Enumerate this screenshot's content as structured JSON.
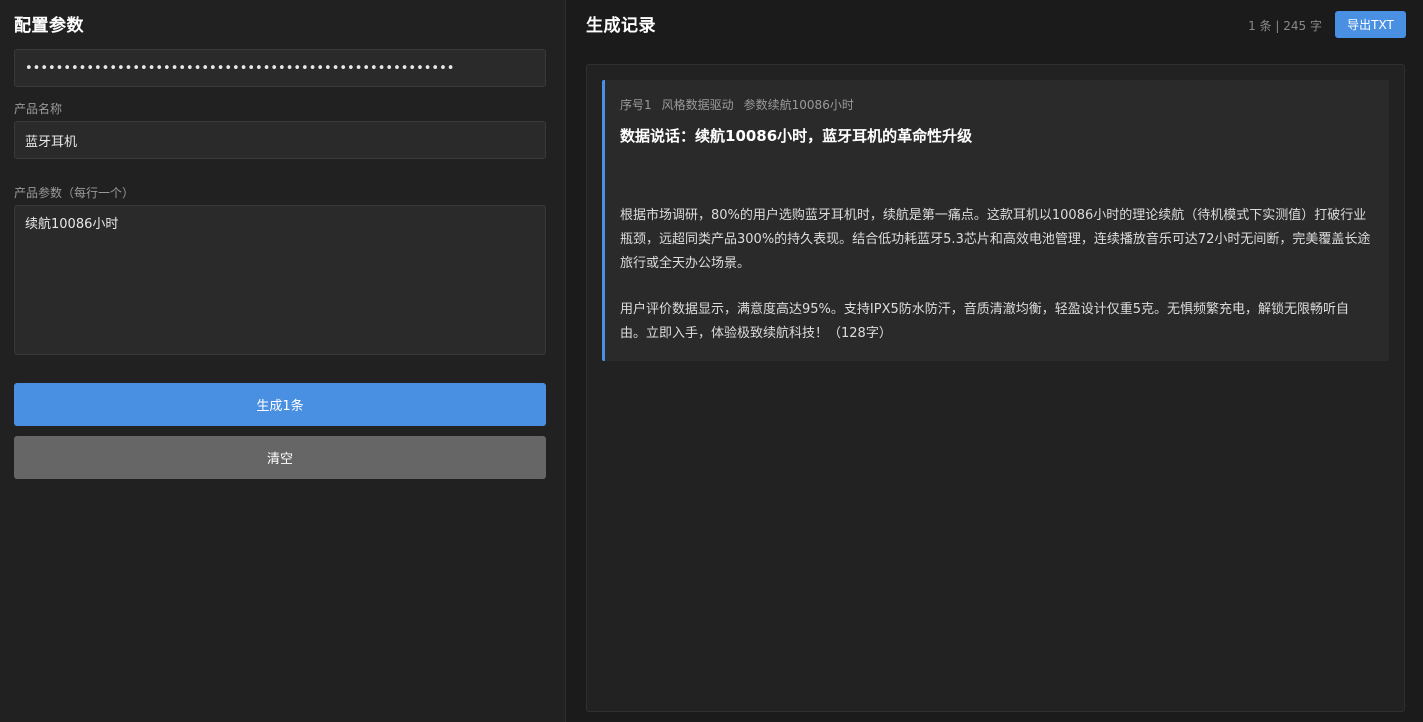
{
  "left": {
    "title": "配置参数",
    "api_key_value": "••••••••••••••••••••••••••••••••••••••••••••••••••••••••",
    "product_name_label": "产品名称",
    "product_name_value": "蓝牙耳机",
    "params_label": "产品参数（每行一个）",
    "params_value": "续航10086小时",
    "generate_label": "生成1条",
    "clear_label": "清空"
  },
  "right": {
    "title": "生成记录",
    "stats": "1 条 | 245 字",
    "export_label": "导出TXT",
    "records": [
      {
        "index": "序号1",
        "style": "风格数据驱动",
        "param": "参数续航10086小时",
        "title": "数据说话：续航10086小时，蓝牙耳机的革命性升级",
        "para1": "根据市场调研，80%的用户选购蓝牙耳机时，续航是第一痛点。这款耳机以10086小时的理论续航（待机模式下实测值）打破行业瓶颈，远超同类产品300%的持久表现。结合低功耗蓝牙5.3芯片和高效电池管理，连续播放音乐可达72小时无间断，完美覆盖长途旅行或全天办公场景。",
        "para2": "用户评价数据显示，满意度高达95%。支持IPX5防水防汗，音质清澈均衡，轻盈设计仅重5克。无惧频繁充电，解锁无限畅听自由。立即入手，体验极致续航科技！（128字）"
      }
    ]
  },
  "colors": {
    "accent": "#4a90e2",
    "clear_button": "#666666",
    "panel_bg": "#212121",
    "page_bg": "#1b1b1b"
  }
}
